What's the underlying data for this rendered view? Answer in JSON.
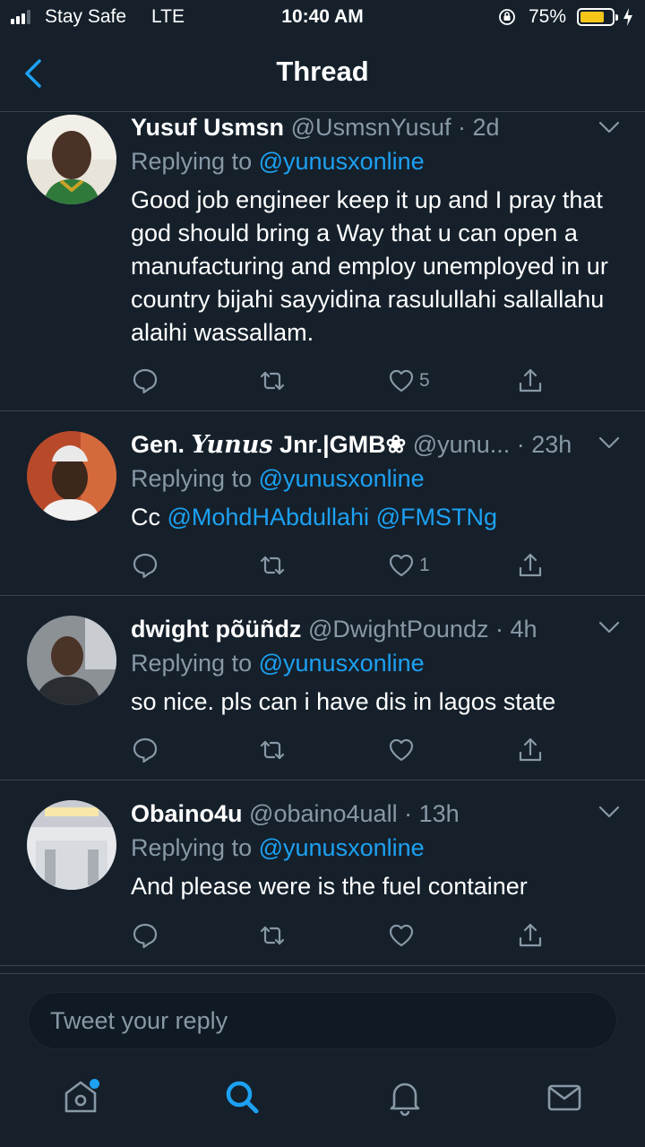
{
  "status": {
    "carrier": "Stay Safe",
    "network": "LTE",
    "time": "10:40 AM",
    "battery_pct": "75%",
    "battery_level": 0.75
  },
  "header": {
    "title": "Thread"
  },
  "tweets": [
    {
      "name": "Yusuf Usmsn",
      "handle": "@UsmsnYusuf",
      "sep": " · ",
      "time": "2d",
      "reply_prefix": "Replying to",
      "reply_to": "@yunusxonline",
      "text": "Good job engineer keep it up and I pray that god should bring a Way that u can open a manufacturing and employ unemployed in ur country bijahi sayyidina rasulullahi sallallahu alaihi wassallam.",
      "likes": "5"
    },
    {
      "name_prefix": "Gen. ",
      "name_styled": "Yunus",
      "name_suffix": " Jnr.|GMB❀",
      "handle": "@yunu...",
      "sep": " · ",
      "time": "23h",
      "reply_prefix": "Replying to",
      "reply_to": "@yunusxonline",
      "text_prefix": "Cc ",
      "mention1": "@MohdHAbdullahi",
      "mention2": "@FMSTNg",
      "likes": "1"
    },
    {
      "name": "dwight põüñdz",
      "handle": "@DwightPoundz",
      "sep": " · ",
      "time": "4h",
      "reply_prefix": "Replying to",
      "reply_to": "@yunusxonline",
      "text": "so nice. pls can i have dis in lagos state",
      "likes": ""
    },
    {
      "name": "Obaino4u",
      "handle": "@obaino4uall",
      "sep": " · ",
      "time": "13h",
      "reply_prefix": "Replying to",
      "reply_to": "@yunusxonline",
      "text": "And please were is the fuel container",
      "likes": ""
    }
  ],
  "composer": {
    "placeholder": "Tweet your reply"
  },
  "tabs": [
    "home",
    "search",
    "notifications",
    "messages"
  ],
  "colors": {
    "background": "#15202b",
    "accent": "#1da1f2",
    "muted": "#8899a6",
    "divider": "#38444d",
    "battery": "#f5c518"
  }
}
